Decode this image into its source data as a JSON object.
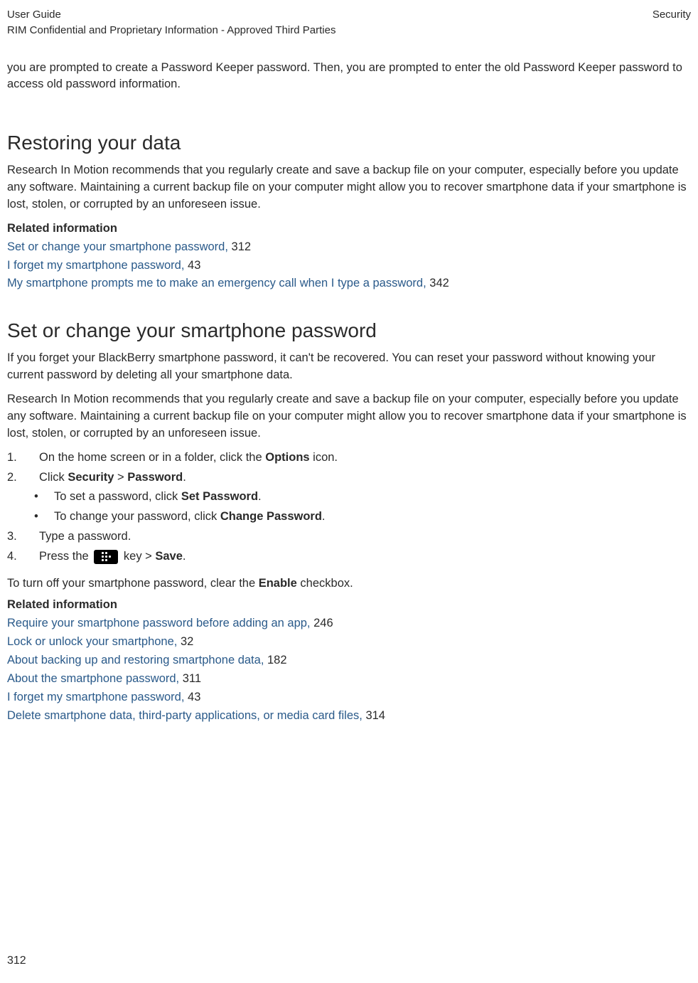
{
  "header": {
    "left_line1": "User Guide",
    "left_line2": "RIM Confidential and Proprietary Information - Approved Third Parties",
    "right": "Security"
  },
  "intro": "you are prompted to create a Password Keeper password. Then, you are prompted to enter the old Password Keeper password to access old password information.",
  "restoring": {
    "title": "Restoring your data",
    "para": "Research In Motion recommends that you regularly create and save a backup file on your computer, especially before you update any software. Maintaining a current backup file on your computer might allow you to recover smartphone data if your smartphone is lost, stolen, or corrupted by an unforeseen issue.",
    "related_heading": "Related information",
    "links": [
      {
        "text": "Set or change your smartphone password,",
        "page": "312"
      },
      {
        "text": "I forget my smartphone password,",
        "page": "43"
      },
      {
        "text": "My smartphone prompts me to make an emergency call when I type a password,",
        "page": "342"
      }
    ]
  },
  "setchange": {
    "title": "Set or change your smartphone password",
    "para1": "If you forget your BlackBerry smartphone password, it can't be recovered. You can reset your password without knowing your current password by deleting all your smartphone data.",
    "para2": "Research In Motion recommends that you regularly create and save a backup file on your computer, especially before you update any software. Maintaining a current backup file on your computer might allow you to recover smartphone data if your smartphone is lost, stolen, or corrupted by an unforeseen issue.",
    "step1_a": "On the home screen or in a folder, click the ",
    "step1_b": "Options",
    "step1_c": " icon.",
    "step2_a": "Click ",
    "step2_b": "Security",
    "step2_c": " > ",
    "step2_d": "Password",
    "step2_e": ".",
    "bullet1_a": "To set a password, click ",
    "bullet1_b": "Set Password",
    "bullet1_c": ".",
    "bullet2_a": "To change your password, click ",
    "bullet2_b": "Change Password",
    "bullet2_c": ".",
    "step3": "Type a password.",
    "step4_a": "Press the ",
    "step4_b": " key > ",
    "step4_c": "Save",
    "step4_d": ".",
    "turnoff_a": "To turn off your smartphone password, clear the ",
    "turnoff_b": "Enable",
    "turnoff_c": " checkbox.",
    "related_heading": "Related information",
    "links": [
      {
        "text": "Require your smartphone password before adding an app,",
        "page": "246"
      },
      {
        "text": "Lock or unlock your smartphone,",
        "page": "32"
      },
      {
        "text": "About backing up and restoring smartphone data,",
        "page": "182"
      },
      {
        "text": "About the smartphone password,",
        "page": "311"
      },
      {
        "text": "I forget my smartphone password,",
        "page": "43"
      },
      {
        "text": "Delete smartphone data, third-party applications, or media card files,",
        "page": "314"
      }
    ]
  },
  "page_number": "312",
  "numbers": {
    "n1": "1.",
    "n2": "2.",
    "n3": "3.",
    "n4": "4."
  },
  "bullet_mark": "•"
}
